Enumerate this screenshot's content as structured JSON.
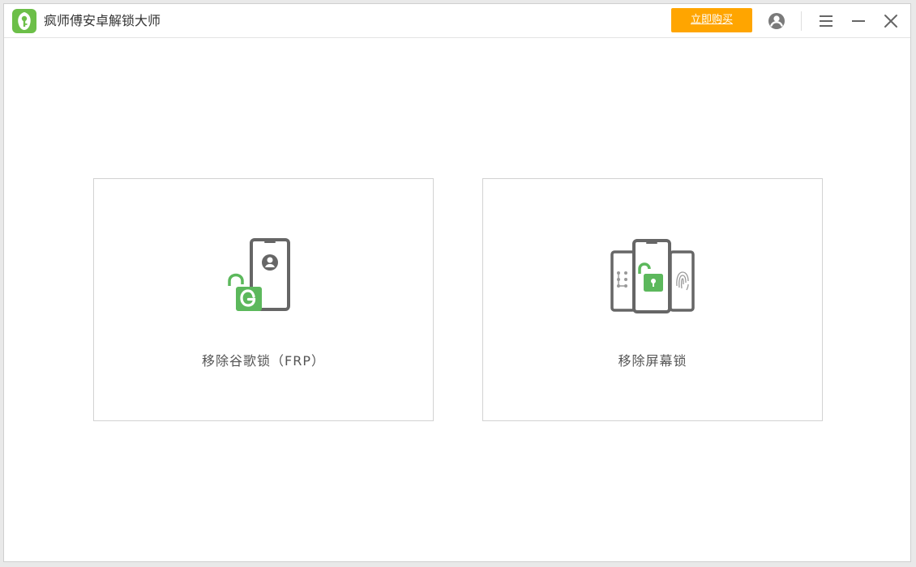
{
  "app": {
    "title": "疯师傅安卓解锁大师",
    "logo_icon": "leaf-key-logo-icon"
  },
  "header": {
    "buy_label": "立即购买",
    "account_icon": "user-icon",
    "menu_icon": "menu-icon",
    "minimize_icon": "minimize-icon",
    "close_icon": "close-icon"
  },
  "features": [
    {
      "label": "移除谷歌锁（FRP）",
      "icon": "google-lock-phone-icon"
    },
    {
      "label": "移除屏幕锁",
      "icon": "screen-unlock-phones-icon"
    }
  ],
  "colors": {
    "accent_green": "#5cb85c",
    "buy_orange": "#ffa500",
    "icon_gray": "#666666"
  }
}
